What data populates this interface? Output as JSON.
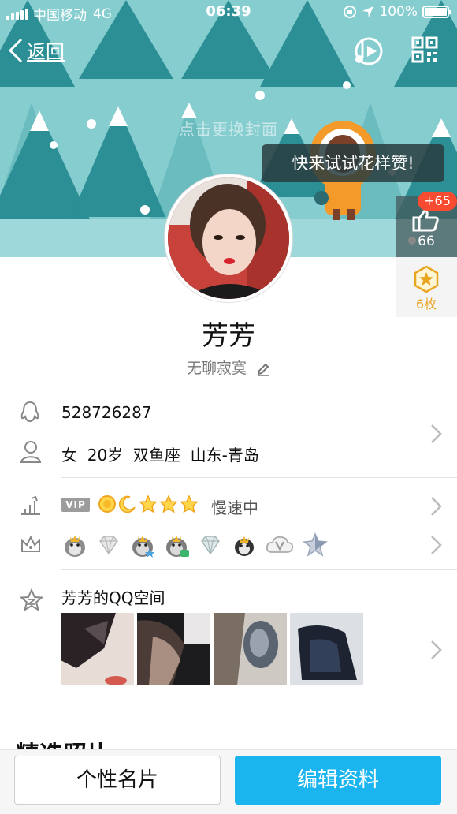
{
  "status_bar": {
    "carrier": "中国移动",
    "network": "4G",
    "time": "06:39",
    "battery": "100%"
  },
  "nav": {
    "back_label": "返回"
  },
  "cover": {
    "hint": "点击更换封面",
    "tooltip": "快来试试花样赞!"
  },
  "likes": {
    "badge": "+65",
    "count": "66"
  },
  "medals": {
    "label": "6枚"
  },
  "profile": {
    "name": "芳芳",
    "signature": "无聊寂寞"
  },
  "info": {
    "qq_number": "528726287",
    "personal": "女  20岁  双鱼座  山东-青岛"
  },
  "level": {
    "vip_tag": "VIP",
    "speed": "慢速中"
  },
  "qzone": {
    "title": "芳芳的QQ空间"
  },
  "section": {
    "partial_heading": "精选照片"
  },
  "actions": {
    "card_label": "个性名片",
    "edit_label": "编辑资料"
  },
  "colors": {
    "accent": "#1ab4ee",
    "like_badge": "#f74c31",
    "medal": "#e8a520"
  }
}
